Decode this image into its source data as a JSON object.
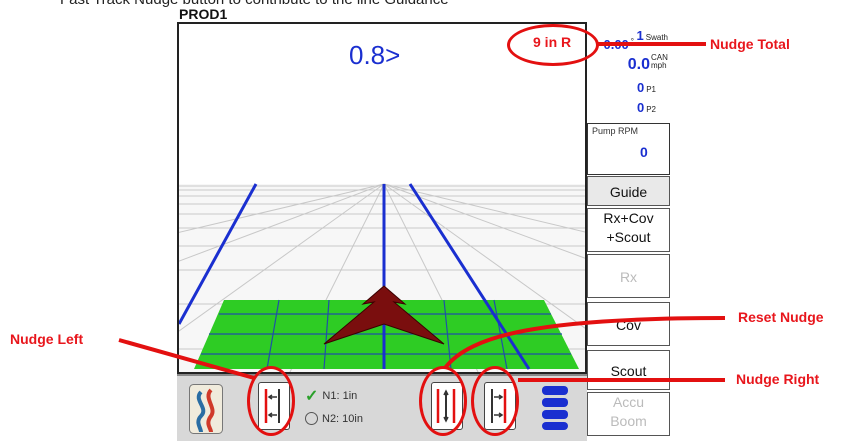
{
  "window": {
    "title": "PROD1",
    "cut_text": "Fast Track Nudge button to contribute to the line Guidance"
  },
  "guidance": {
    "offset": "0.8>"
  },
  "status": {
    "swath_value": "1",
    "swath_unit": "Swath",
    "heading_value": "0.00",
    "heading_unit": "°",
    "speed_value": "0.0",
    "speed_unit_top": "CAN",
    "speed_unit_bottom": "mph",
    "p1_value": "0",
    "p1_label": "P1",
    "p2_value": "0",
    "p2_label": "P2",
    "nudge_total": "9 in R",
    "pump_label": "Pump RPM",
    "pump_value": "0"
  },
  "tabs": [
    "Guide",
    "Rx+Cov\n+Scout",
    "Rx",
    "Cov",
    "Scout",
    "Accu\nBoom"
  ],
  "nudge": {
    "n1": "N1: 1in",
    "n2": "N2: 10in"
  },
  "annotations": {
    "nudge_total": "Nudge Total",
    "nudge_left": "Nudge Left",
    "reset_nudge": "Reset Nudge",
    "nudge_right": "Nudge Right"
  },
  "colors": {
    "accent_blue": "#1a2fd0",
    "annotation_red": "#e8161c",
    "field_green": "#2ecc24",
    "vehicle": "#7a0e0e"
  }
}
